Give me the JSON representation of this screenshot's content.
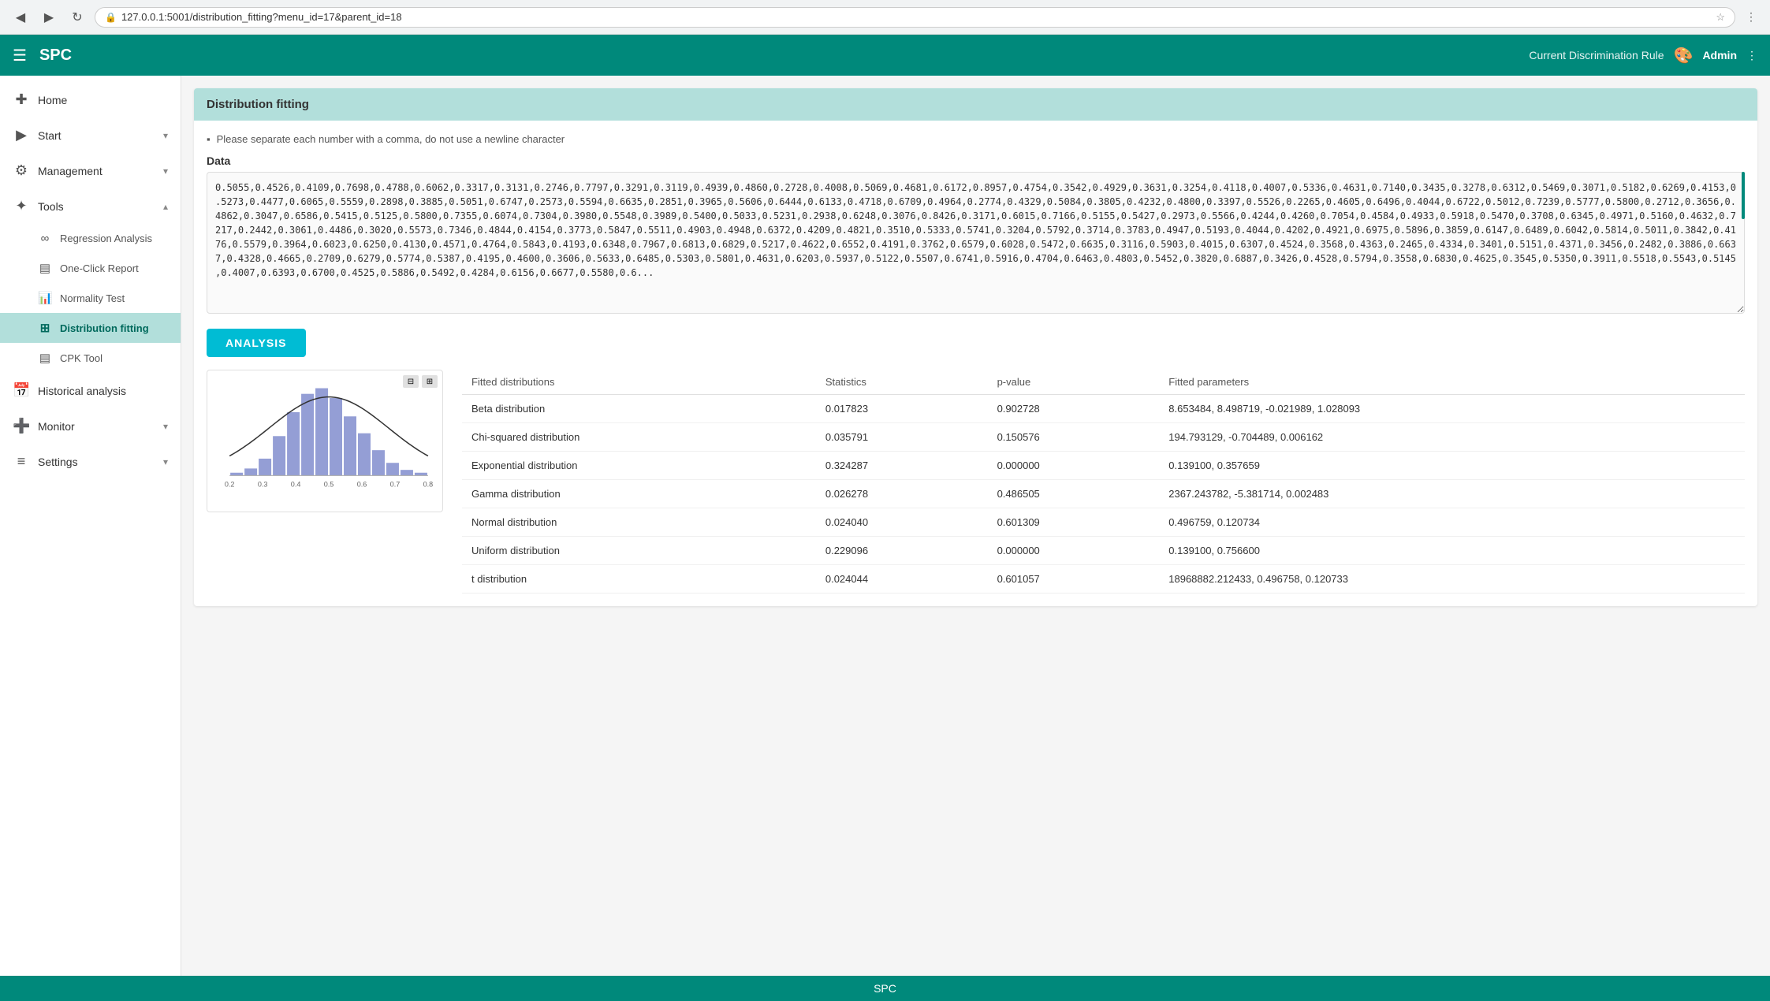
{
  "browser": {
    "url": "127.0.0.1:5001/distribution_fitting?menu_id=17&parent_id=18",
    "back_icon": "◀",
    "forward_icon": "▶",
    "reload_icon": "↻",
    "lock_icon": "🔒",
    "star_icon": "☆"
  },
  "topnav": {
    "hamburger": "☰",
    "title": "SPC",
    "disc_rule": "Current Discrimination Rule",
    "palette_icon": "🎨",
    "admin_label": "Admin",
    "dots_icon": "⋮"
  },
  "sidebar": {
    "home_label": "Home",
    "home_icon": "✚",
    "start_label": "Start",
    "start_icon": "▶",
    "management_label": "Management",
    "management_icon": "⚙",
    "tools_label": "Tools",
    "tools_icon": "✦",
    "tools_expanded": true,
    "sub_items": [
      {
        "label": "Regression Analysis",
        "icon": "∞"
      },
      {
        "label": "One-Click Report",
        "icon": "≡"
      },
      {
        "label": "Normality Test",
        "icon": "📊"
      },
      {
        "label": "Distribution fitting",
        "icon": "⊞",
        "active": true
      },
      {
        "label": "CPK Tool",
        "icon": "≡"
      }
    ],
    "historical_label": "Historical analysis",
    "historical_icon": "📅",
    "monitor_label": "Monitor",
    "monitor_icon": "➕",
    "settings_label": "Settings",
    "settings_icon": "≡"
  },
  "main": {
    "card_title": "Distribution fitting",
    "notice": "Please separate each number with a comma, do not use a newline character",
    "data_label": "Data",
    "data_value": "0.5055,0.4526,0.4109,0.7698,0.4788,0.6062,0.3317,0.3131,0.2746,0.7797,0.3291,0.3119,0.4939,0.4860,0.2728,0.4008,0.5069,0.4681,0.6172,0.8957,0.4754,0.3542,0.4929,0.3631,0.3254,0.4118,0.4007,0.5336,0.4631,0.7140,0.3435,0.3278,0.6312,0.5469,0.3071,0.5182,0.6269,0.4153,0.5273,0.4477,0.6065,0.5559,0.2898,0.3885,0.5051,0.6747,0.2573,0.5594,0.6635,0.2851,0.3965,0.5606,0.6444,0.6133,0.4718,0.6709,0.4964,0.2774,0.4329,0.5084,0.3805,0.4232,0.4800,0.3397,0.5526,0.2265,0.4605,0.6496,0.4044,0.6722,0.5012,0.7239,0.5777,0.5800,0.2712,0.3656,0.4862,0.3047,0.6586,0.5415,0.5125,0.5800,0.7355,0.6074,0.7304,0.3980,0.5548,0.3989,0.5400,0.5033,0.5231,0.2938,0.6248,0.3076,0.8426,0.3171,0.6015,0.7166,0.5155,0.5427,0.2973,0.5566,0.4244,0.4260,0.7054,0.4584,0.4933,0.5918,0.5470,0.3708,0.6345,0.4971,0.5160,0.4632,0.7217,0.2442,0.3061,0.4486,0.3020,0.5573,0.7346,0.4844,0.4154,0.3773,0.5847,0.5511,0.4903,0.4948,0.6372,0.4209,0.4821,0.3510,0.5333,0.5741,0.3204,0.5792,0.3714,0.3783,0.4947,0.5193,0.4044,0.4202,0.4921,0.6975,0.5896,0.3859,0.6147,0.6489,0.6042,0.5814,0.5011,0.3842,0.4176,0.5579,0.3964,0.6023,0.6250,0.4130,0.4571,0.4764,0.5843,0.4193,0.6348,0.7967,0.6813,0.6829,0.5217,0.4622,0.6552,0.4191,0.3762,0.6579,0.6028,0.5472,0.6635,0.3116,0.5903,0.4015,0.6307,0.4524,0.3568,0.4363,0.2465,0.4334,0.3401,0.5151,0.4371,0.3456,0.2482,0.3886,0.6637,0.4328,0.4665,0.2709,0.6279,0.5774,0.5387,0.4195,0.4600,0.3606,0.5633,0.6485,0.5303,0.5801,0.4631,0.6203,0.5937,0.5122,0.5507,0.6741,0.5916,0.4704,0.6463,0.4803,0.5452,0.3820,0.6887,0.3426,0.4528,0.5794,0.3558,0.6830,0.4625,0.3545,0.5350,0.3911,0.5518,0.5543,0.5145,0.4007,0.6393,0.6700,0.4525,0.5886,0.5492,0.4284,0.6156,0.6677,0.5580,0.6...",
    "analysis_btn": "ANALYSIS",
    "table": {
      "headers": [
        "Fitted distributions",
        "Statistics",
        "p-value",
        "Fitted parameters"
      ],
      "rows": [
        {
          "dist": "Beta distribution",
          "stat": "0.017823",
          "pval": "0.902728",
          "params": "8.653484, 8.498719, -0.021989, 1.028093"
        },
        {
          "dist": "Chi-squared distribution",
          "stat": "0.035791",
          "pval": "0.150576",
          "params": "194.793129, -0.704489, 0.006162"
        },
        {
          "dist": "Exponential distribution",
          "stat": "0.324287",
          "pval": "0.000000",
          "params": "0.139100, 0.357659"
        },
        {
          "dist": "Gamma distribution",
          "stat": "0.026278",
          "pval": "0.486505",
          "params": "2367.243782, -5.381714, 0.002483"
        },
        {
          "dist": "Normal distribution",
          "stat": "0.024040",
          "pval": "0.601309",
          "params": "0.496759, 0.120734"
        },
        {
          "dist": "Uniform distribution",
          "stat": "0.229096",
          "pval": "0.000000",
          "params": "0.139100, 0.756600"
        },
        {
          "dist": "t distribution",
          "stat": "0.024044",
          "pval": "0.601057",
          "params": "18968882.212433, 0.496758, 0.120733"
        }
      ]
    }
  },
  "footer": {
    "label": "SPC"
  },
  "chart": {
    "bars": [
      2,
      5,
      12,
      28,
      45,
      58,
      62,
      55,
      42,
      30,
      18,
      9,
      4,
      2
    ],
    "bar_color": "#7986cb",
    "curve_color": "#333"
  }
}
